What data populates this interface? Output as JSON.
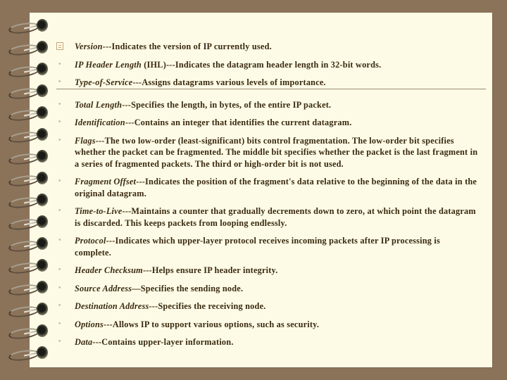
{
  "slide": {
    "items": [
      {
        "icon": "document-icon",
        "term": "Version",
        "desc": "---Indicates the version of IP currently used."
      },
      {
        "icon": "bullet",
        "term": "IP Header Length",
        "desc": " (IHL)---Indicates the datagram header length in 32-bit words."
      },
      {
        "icon": "bullet",
        "term": "Type-of-Service",
        "desc": "---Assigns datagrams various levels of importance."
      },
      {
        "icon": "bullet",
        "term": "Total Length",
        "desc": "---Specifies the length, in bytes, of the entire IP packet."
      },
      {
        "icon": "bullet",
        "term": "Identification",
        "desc": "---Contains an integer that identifies the current datagram."
      },
      {
        "icon": "bullet",
        "term": "Flags",
        "desc": "---The two low-order (least-significant) bits control fragmentation. The low-order bit specifies whether the packet can be fragmented. The middle bit specifies whether the packet is the last fragment in a series of fragmented packets. The third or high-order bit is not used."
      },
      {
        "icon": "bullet",
        "term": "Fragment Offset",
        "desc": "---Indicates the position of the fragment's data relative to the beginning of the data in the original datagram."
      },
      {
        "icon": "bullet",
        "term": "Time-to-Live",
        "desc": "---Maintains a counter that gradually decrements down to zero, at which point the datagram is discarded. This keeps packets from looping endlessly."
      },
      {
        "icon": "bullet",
        "term": "Protocol",
        "desc": "---Indicates which upper-layer protocol receives incoming packets after IP processing is complete."
      },
      {
        "icon": "bullet",
        "term": "Header Checksum",
        "desc": "---Helps ensure IP header integrity."
      },
      {
        "icon": "bullet",
        "term": "Source Address",
        "desc": "—Specifies the sending node."
      },
      {
        "icon": "bullet",
        "term": "Destination Address",
        "desc": "---Specifies the receiving node."
      },
      {
        "icon": "bullet",
        "term": "Options",
        "desc": "---Allows IP to support various options, such as security."
      },
      {
        "icon": "bullet",
        "term": "Data",
        "desc": "---Contains upper-layer information."
      }
    ],
    "bullet_glyph": "•",
    "colors": {
      "background": "#8b735a",
      "paper": "#fdfbe6",
      "text": "#3a2a10",
      "bullet": "#c8b896",
      "rule": "#9c8a70"
    }
  }
}
